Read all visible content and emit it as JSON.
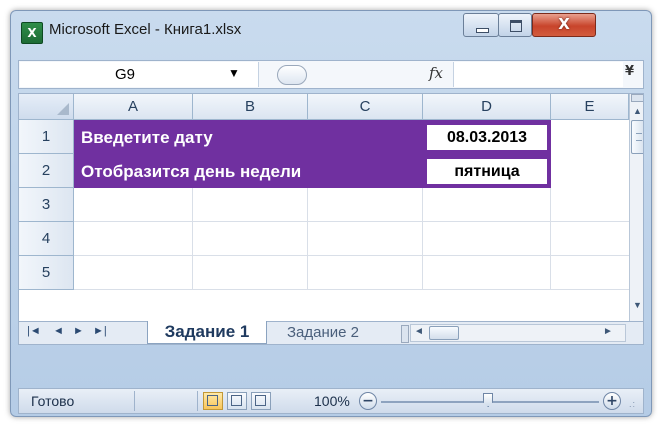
{
  "window": {
    "title": "Microsoft Excel - Книга1.xlsx",
    "app_icon_glyph": "X",
    "close_glyph": "X"
  },
  "formula_bar": {
    "name_box": "G9",
    "name_box_arrow": "▼",
    "fx_label": "fx",
    "formula": "",
    "expand_glyph": "¥"
  },
  "grid": {
    "columns": [
      "A",
      "B",
      "C",
      "D",
      "E"
    ],
    "rows": [
      "1",
      "2",
      "3",
      "4",
      "5"
    ],
    "cells": {
      "A1": "Введетите дату",
      "A2": "Отобразится день недели",
      "D1": "08.03.2013",
      "D2": "пятница"
    },
    "highlight_color": "#7030a0"
  },
  "sheet_tabs": {
    "nav_first": "|◄",
    "nav_prev": "◄",
    "nav_next": "►",
    "nav_last": "►|",
    "active": "Задание 1",
    "inactive": "Задание 2"
  },
  "status_bar": {
    "status": "Готово",
    "zoom": "100%",
    "zoom_minus": "−",
    "zoom_plus": "+"
  }
}
